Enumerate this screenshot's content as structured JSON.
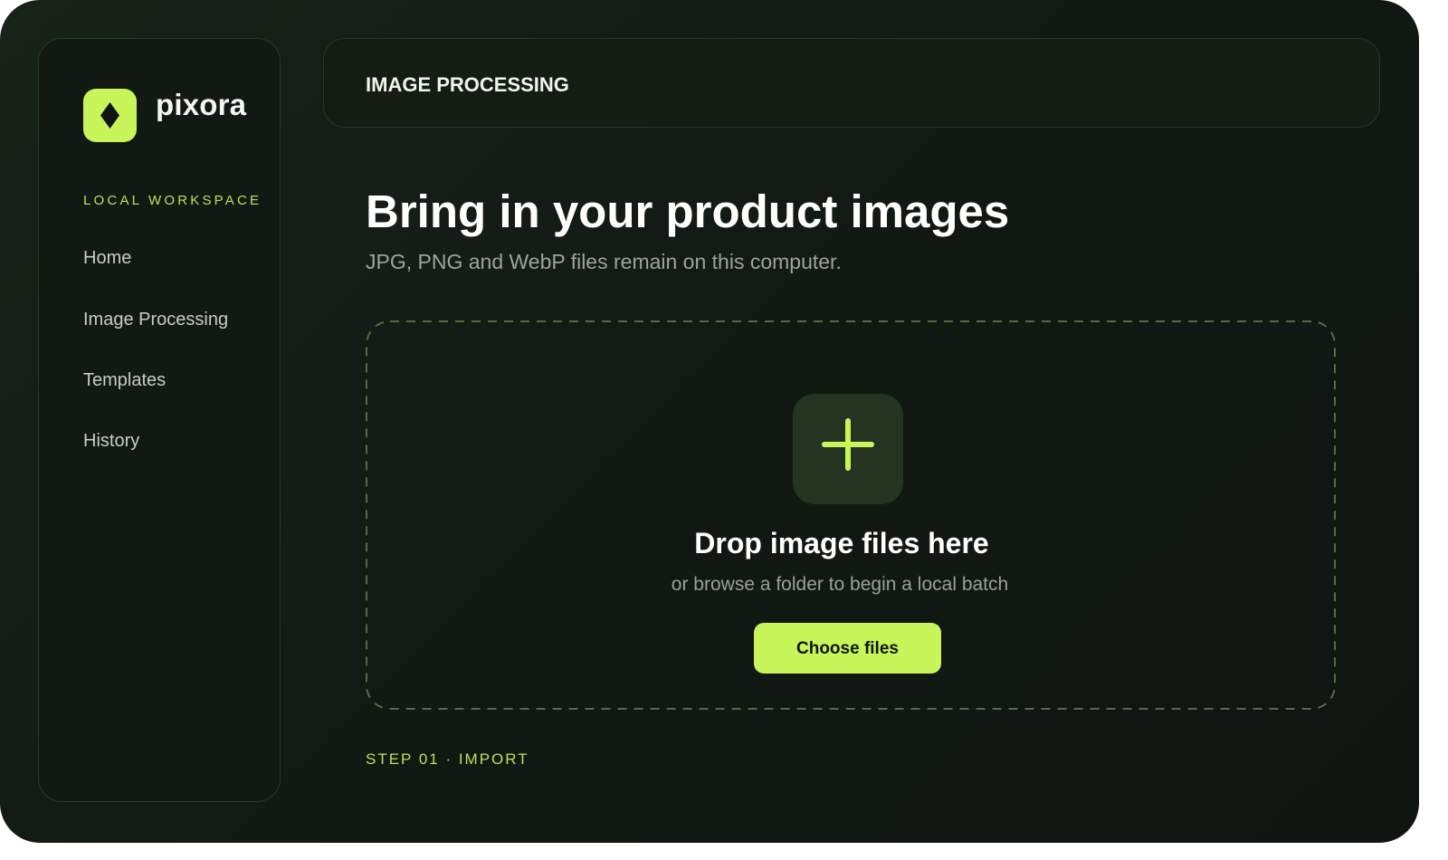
{
  "app": {
    "brand": "pixora",
    "logo_icon": "diamond-icon",
    "accent_color": "#c8f55a"
  },
  "sidebar": {
    "section_label": "LOCAL WORKSPACE",
    "items": [
      {
        "label": "Home"
      },
      {
        "label": "Image Processing"
      },
      {
        "label": "Templates"
      },
      {
        "label": "History"
      }
    ]
  },
  "header": {
    "title": "IMAGE PROCESSING"
  },
  "main": {
    "headline": "Bring in your product images",
    "subheadline": "JPG, PNG and WebP files remain on this computer.",
    "dropzone": {
      "icon": "plus-icon",
      "title": "Drop image files here",
      "subtitle": "or browse a folder to begin a local batch",
      "button_label": "Choose files"
    },
    "step_label": "STEP 01 · IMPORT"
  }
}
